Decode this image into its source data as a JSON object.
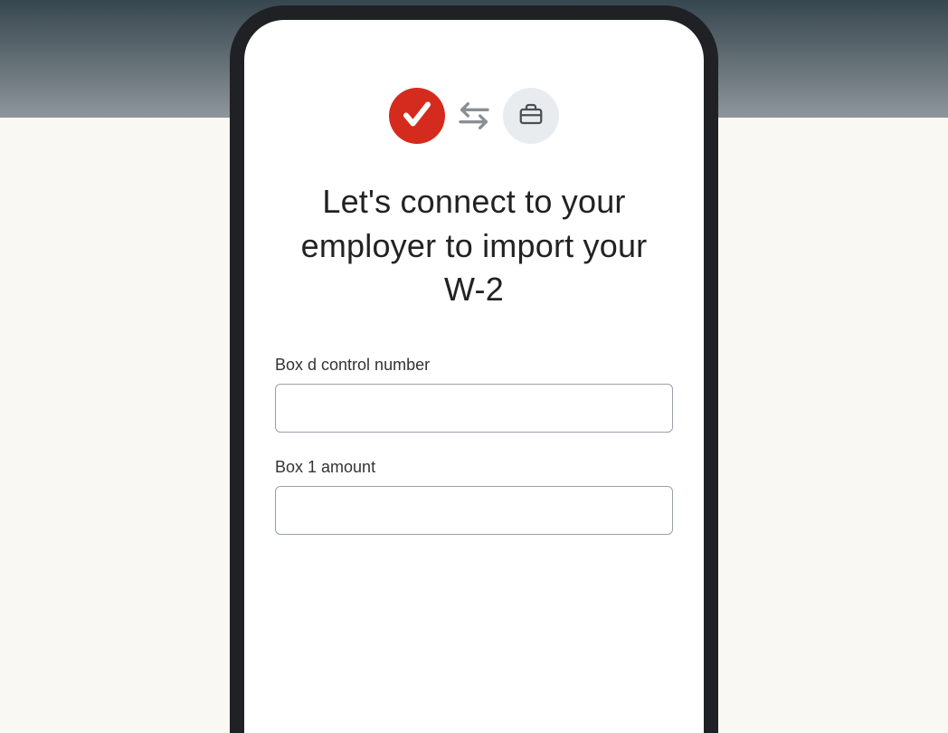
{
  "heading": "Let's connect to your employer to import your W-2",
  "fields": {
    "box_d": {
      "label": "Box d control number",
      "value": ""
    },
    "box_1": {
      "label": "Box 1 amount",
      "value": ""
    }
  },
  "icons": {
    "check": "check-icon",
    "swap": "swap-arrows-icon",
    "briefcase": "briefcase-icon"
  },
  "colors": {
    "accent_red": "#d52b1e",
    "neutral_badge": "#e9ecef",
    "input_border": "#9aa0a6"
  }
}
